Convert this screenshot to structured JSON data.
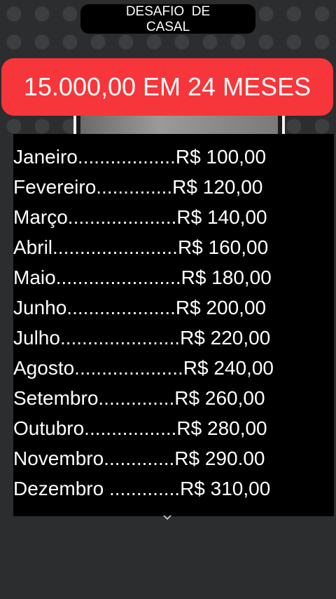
{
  "header": {
    "title_line1": "DESAFIO  DE",
    "title_line2": "CASAL"
  },
  "banner": {
    "text": "15.000,00 EM 24 MESES"
  },
  "months": [
    "Janeiro..................R$ 100,00",
    "Fevereiro..............R$ 120,00",
    "Março....................R$ 140,00",
    "Abril.......................R$ 160,00",
    "Maio.......................R$ 180,00",
    "Junho....................R$ 200,00",
    "Julho......................R$ 220,00",
    "Agosto....................R$ 240,00",
    "Setembro..............R$ 260,00",
    "Outubro.................R$ 280,00",
    "Novembro.............R$ 290.00",
    "Dezembro .............R$ 310,00"
  ],
  "icons": {
    "chevron": "chevron-down-icon"
  }
}
